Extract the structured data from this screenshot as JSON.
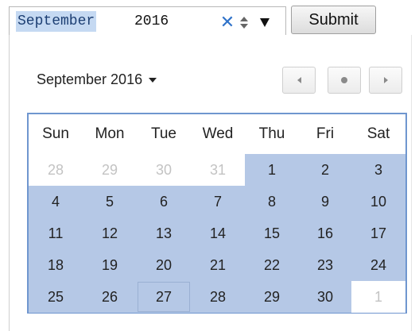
{
  "input": {
    "month": "September",
    "year": "2016",
    "clear_symbol": "✕"
  },
  "submit_label": "Submit",
  "picker": {
    "title": "September 2016",
    "weekdays": [
      "Sun",
      "Mon",
      "Tue",
      "Wed",
      "Thu",
      "Fri",
      "Sat"
    ],
    "weeks": [
      [
        {
          "d": "28",
          "o": true
        },
        {
          "d": "29",
          "o": true
        },
        {
          "d": "30",
          "o": true
        },
        {
          "d": "31",
          "o": true
        },
        {
          "d": "1"
        },
        {
          "d": "2"
        },
        {
          "d": "3"
        }
      ],
      [
        {
          "d": "4"
        },
        {
          "d": "5"
        },
        {
          "d": "6"
        },
        {
          "d": "7"
        },
        {
          "d": "8"
        },
        {
          "d": "9"
        },
        {
          "d": "10"
        }
      ],
      [
        {
          "d": "11"
        },
        {
          "d": "12"
        },
        {
          "d": "13"
        },
        {
          "d": "14"
        },
        {
          "d": "15"
        },
        {
          "d": "16"
        },
        {
          "d": "17"
        }
      ],
      [
        {
          "d": "18"
        },
        {
          "d": "19"
        },
        {
          "d": "20"
        },
        {
          "d": "21"
        },
        {
          "d": "22"
        },
        {
          "d": "23"
        },
        {
          "d": "24"
        }
      ],
      [
        {
          "d": "25"
        },
        {
          "d": "26"
        },
        {
          "d": "27",
          "today": true
        },
        {
          "d": "28"
        },
        {
          "d": "29"
        },
        {
          "d": "30"
        },
        {
          "d": "1",
          "o": true
        }
      ]
    ]
  },
  "icons": {
    "spin": "spinner-arrows-icon",
    "dropdown": "dropdown-arrow-icon",
    "prev": "chevron-left-icon",
    "today": "dot-icon",
    "next": "chevron-right-icon"
  }
}
